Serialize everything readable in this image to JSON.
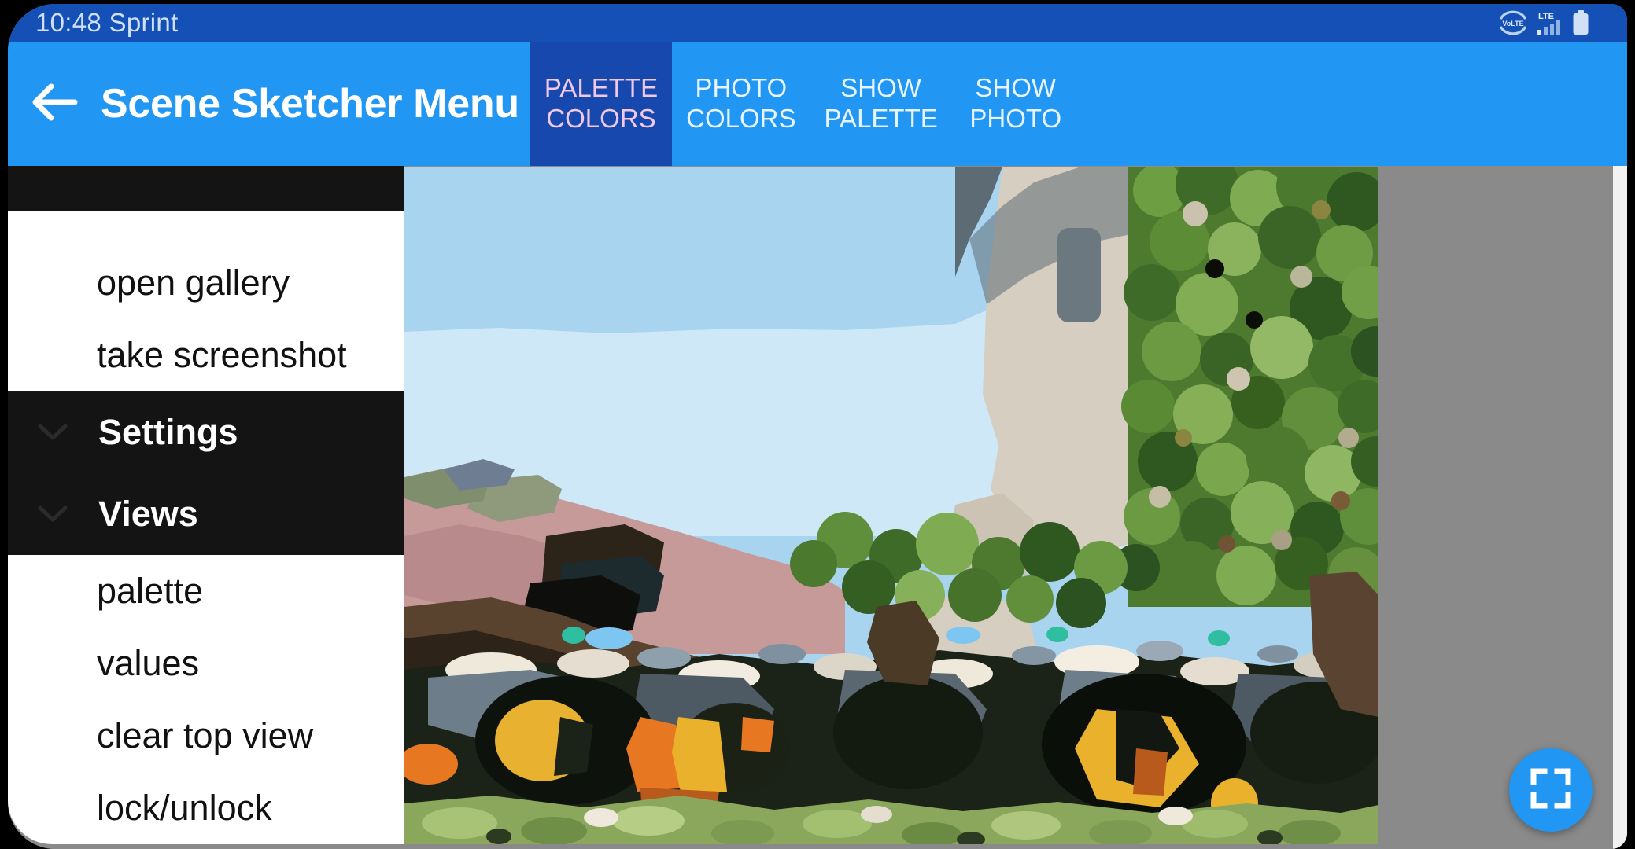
{
  "status_bar": {
    "time": "10:48",
    "carrier": "Sprint",
    "time_carrier": "10:48 Sprint",
    "icons": [
      "volte-icon",
      "lte-signal-icon",
      "battery-icon"
    ],
    "background_color": "#1450b5",
    "text_color": "#cfe0f7"
  },
  "app_bar": {
    "back_label": "back-arrow-icon",
    "title": "Scene Sketcher Menu",
    "overflow_label": "overflow-menu-icon",
    "background_color": "#2196f3",
    "title_color": "#ffffff",
    "tabs": [
      {
        "line1": "PALETTE",
        "line2": "COLORS",
        "selected": true
      },
      {
        "line1": "PHOTO",
        "line2": "COLORS",
        "selected": false
      },
      {
        "line1": "SHOW",
        "line2": "PALETTE",
        "selected": false
      },
      {
        "line1": "SHOW",
        "line2": "PHOTO",
        "selected": false
      }
    ],
    "selected_tab_background": "#1748ad",
    "selected_tab_text_color": "#f2c8e8"
  },
  "drawer": {
    "top_items": [
      {
        "label": "open gallery"
      },
      {
        "label": "take screenshot"
      }
    ],
    "groups": [
      {
        "label": "Settings",
        "chevron": "chevron-down-icon"
      },
      {
        "label": "Views",
        "chevron": "chevron-down-icon"
      }
    ],
    "view_items": [
      {
        "label": "palette"
      },
      {
        "label": "values"
      },
      {
        "label": "clear top view"
      },
      {
        "label": "lock/unlock"
      }
    ],
    "light_background": "#ffffff",
    "dark_background": "#141414"
  },
  "canvas": {
    "name": "posterized-scene-artwork",
    "description": "Posterized painted scene: blue sky, stone building with ivy, dense green foliage, dark foreground figures with orange and yellow accents",
    "background_color": "#8a8a8a"
  },
  "fab": {
    "icon": "fullscreen-expand-icon",
    "color": "#2196f3"
  }
}
